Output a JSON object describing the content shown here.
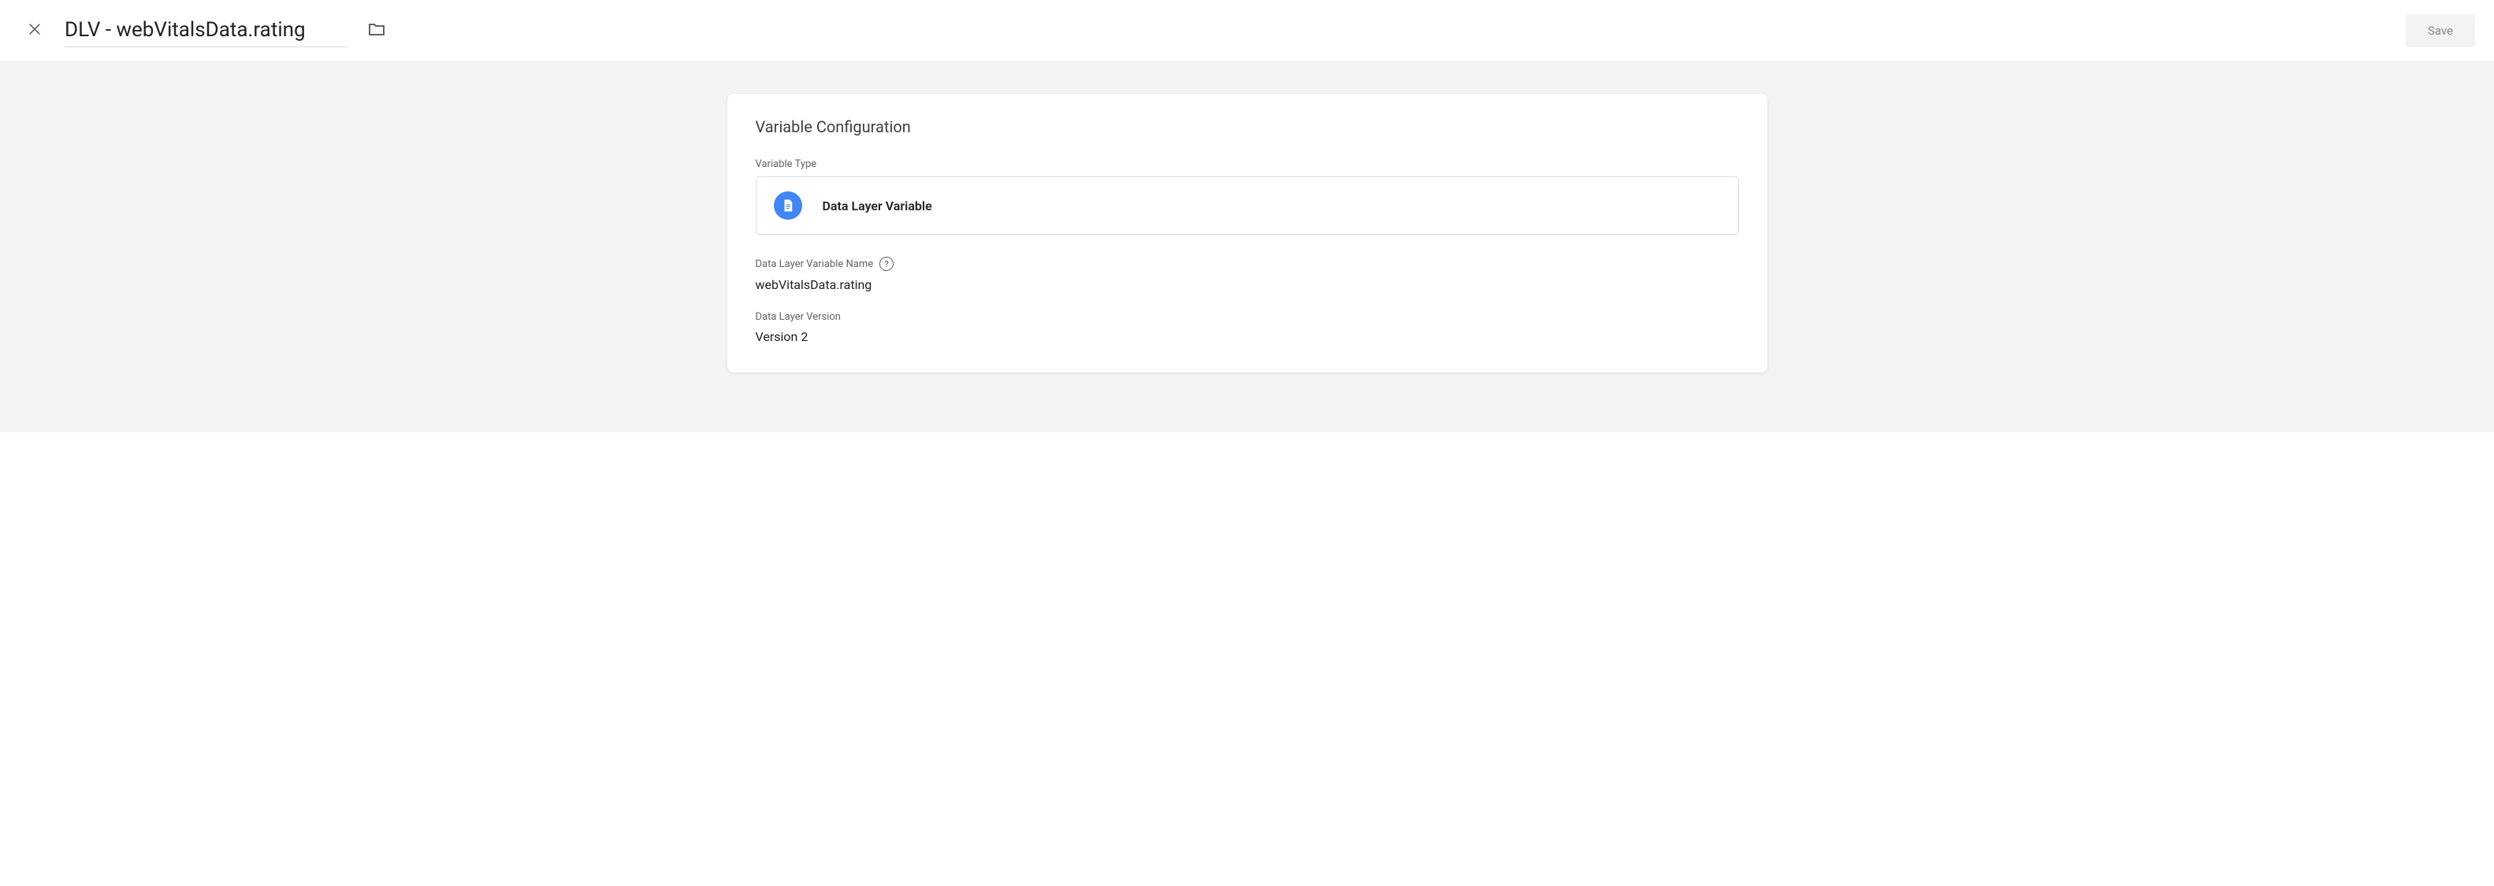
{
  "header": {
    "title": "DLV - webVitalsData.rating",
    "save_label": "Save"
  },
  "card": {
    "title": "Variable Configuration",
    "type_label": "Variable Type",
    "type_value": "Data Layer Variable",
    "type_icon": "data-layer-icon",
    "fields": {
      "name_label": "Data Layer Variable Name",
      "name_value": "webVitalsData.rating",
      "version_label": "Data Layer Version",
      "version_value": "Version 2"
    }
  }
}
